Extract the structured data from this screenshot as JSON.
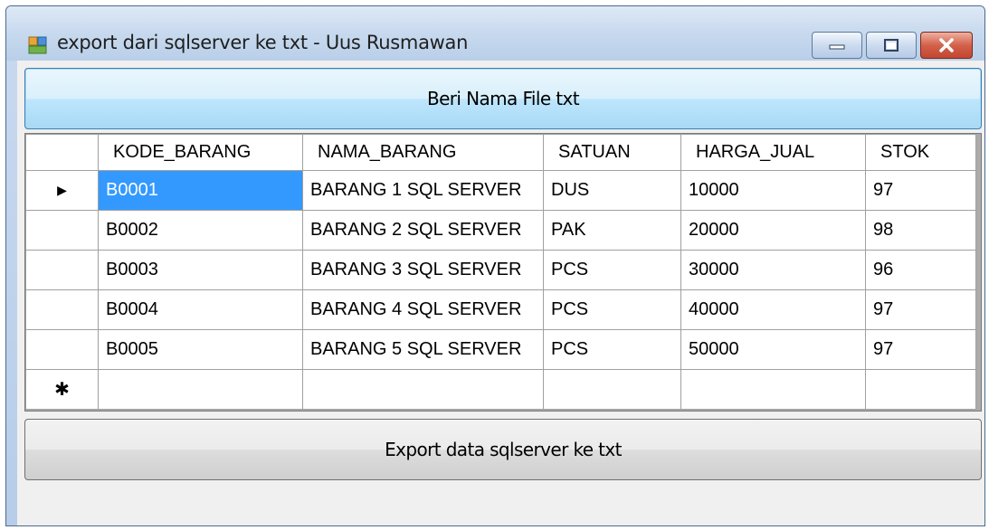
{
  "window": {
    "title": "export dari sqlserver ke txt - Uus Rusmawan",
    "icon": "form-icon"
  },
  "buttons": {
    "name_file": "Beri Nama File txt",
    "export": "Export data sqlserver ke txt"
  },
  "grid": {
    "columns": [
      "KODE_BARANG",
      "NAMA_BARANG",
      "SATUAN",
      "HARGA_JUAL",
      "STOK"
    ],
    "rows": [
      [
        "B0001",
        "BARANG 1 SQL SERVER",
        "DUS",
        "10000",
        "97"
      ],
      [
        "B0002",
        "BARANG 2 SQL SERVER",
        "PAK",
        "20000",
        "98"
      ],
      [
        "B0003",
        "BARANG 3 SQL SERVER",
        "PCS",
        "30000",
        "96"
      ],
      [
        "B0004",
        "BARANG 4 SQL SERVER",
        "PCS",
        "40000",
        "97"
      ],
      [
        "B0005",
        "BARANG 5 SQL SERVER",
        "PCS",
        "50000",
        "97"
      ]
    ],
    "current_row_glyph": "▶",
    "new_row_glyph": "✱"
  },
  "colors": {
    "selection": "#3399ff",
    "title_bar": "#c7d9ee",
    "close_button": "#c24630"
  }
}
